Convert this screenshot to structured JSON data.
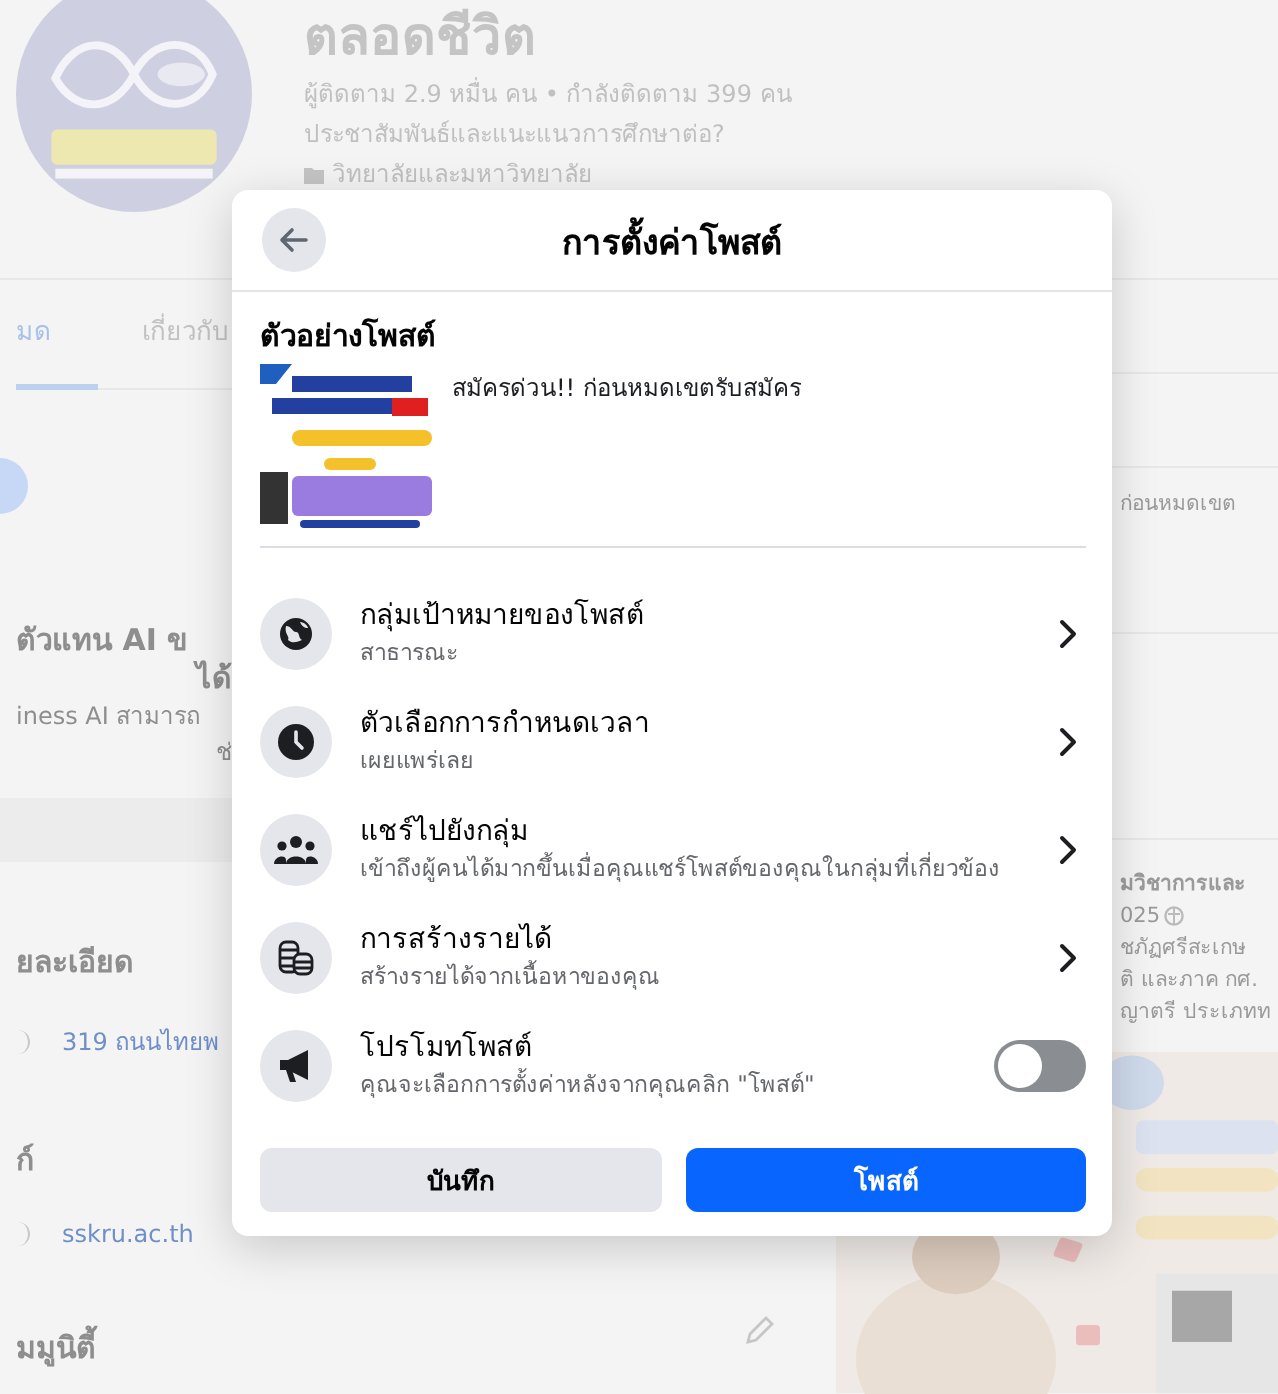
{
  "page": {
    "title": "ตลอดชีวิต",
    "followers": "ผู้ติดตาม 2.9 หมื่น คน • กำลังติดตาม 399 คน",
    "bio": "ประชาสัมพันธ์และแนะแนวการศึกษาต่อ?",
    "category": "วิทยาลัยและมหาวิทยาลัย",
    "tabs": [
      {
        "label": "มด",
        "selected": true
      },
      {
        "label": "เกี่ยวกับ",
        "selected": false
      }
    ],
    "ai_title": [
      "ตัวแทน AI ข",
      "ได้"
    ],
    "ai_text": [
      "iness AI สามารถ",
      "ช่"
    ],
    "details_heading": "ยละเอียด",
    "address": "319 ถนนไทยพ",
    "links_heading": "ก์",
    "website": "sskru.ac.th",
    "community_heading": "มมูนิตี้",
    "right_texts": [
      "ก่อนหมดเขต"
    ],
    "post_title": "มวิชาการและ",
    "post_date": "025",
    "post_lines": [
      "ชภัฏศรีสะเกษ",
      "ติ และภาค กศ.",
      "ญาตรี ประเภทท"
    ]
  },
  "dialog": {
    "title": "การตั้งค่าโพสต์",
    "preview_heading": "ตัวอย่างโพสต์",
    "preview_text": "สมัครด่วน!! ก่อนหมดเขตรับสมัคร",
    "options": [
      {
        "kind": "link",
        "title": "กลุ่มเป้าหมายของโพสต์",
        "subtitle": "สาธารณะ"
      },
      {
        "kind": "link",
        "title": "ตัวเลือกการกำหนดเวลา",
        "subtitle": "เผยแพร่เลย"
      },
      {
        "kind": "link",
        "title": "แชร์ไปยังกลุ่ม",
        "subtitle": "เข้าถึงผู้คนได้มากขึ้นเมื่อคุณแชร์โพสต์ของคุณในกลุ่มที่เกี่ยวข้อง"
      },
      {
        "kind": "link",
        "title": "การสร้างรายได้",
        "subtitle": "สร้างรายได้จากเนื้อหาของคุณ"
      },
      {
        "kind": "toggle",
        "title": "โปรโมทโพสต์",
        "subtitle": "คุณจะเลือกการตั้งค่าหลังจากคุณคลิก \"โพสต์\"",
        "on": false
      }
    ],
    "buttons": [
      {
        "label": "บันทึก",
        "kind": "secondary"
      },
      {
        "label": "โพสต์",
        "kind": "primary"
      }
    ]
  }
}
